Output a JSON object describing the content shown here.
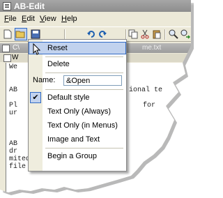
{
  "window": {
    "title": "AB-Edit"
  },
  "menubar": [
    {
      "label": "File",
      "key": "F"
    },
    {
      "label": "Edit",
      "key": "E"
    },
    {
      "label": "View",
      "key": "V"
    },
    {
      "label": "Help",
      "key": "H"
    }
  ],
  "document": {
    "title_prefix": "C\\",
    "title_right": "me.txt",
    "tab_letter": "W"
  },
  "editor_lines": [
    "We",
    "",
    "",
    "AB",
    "",
    "Pl",
    "ur",
    "",
    "",
    "AB",
    "dr",
    "mited Undo/Redo",
    "file types,"
  ],
  "editor_right_fragments": [
    "ional te",
    "for"
  ],
  "context_menu": {
    "reset": "Reset",
    "delete": "Delete",
    "name_label": "Name:",
    "name_value": "&Open",
    "default_style": "Default style",
    "text_only_always": "Text Only (Always)",
    "text_only_menus": "Text Only (in Menus)",
    "image_and_text": "Image and Text",
    "begin_group": "Begin a Group",
    "checked_item": "Default style"
  },
  "icons": [
    "app-icon",
    "new-file-icon",
    "open-folder-icon",
    "save-icon",
    "undo-icon",
    "redo-icon",
    "cut-icon",
    "copy-icon",
    "paste-icon",
    "find-icon",
    "replace-icon",
    "checkmark-icon",
    "arrow-cursor-icon"
  ],
  "colors": {
    "highlight": "#c1d2ee",
    "highlight_border": "#316ac5",
    "chrome": "#ece9d8",
    "titlebar": "#9a9a9a"
  }
}
